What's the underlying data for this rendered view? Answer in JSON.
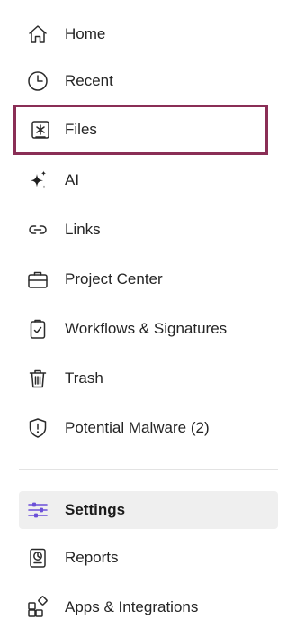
{
  "nav": {
    "items": [
      {
        "label": "Home",
        "icon": "home-icon"
      },
      {
        "label": "Recent",
        "icon": "clock-icon"
      },
      {
        "label": "Files",
        "icon": "files-icon"
      },
      {
        "label": "AI",
        "icon": "sparkle-icon"
      },
      {
        "label": "Links",
        "icon": "link-icon"
      },
      {
        "label": "Project Center",
        "icon": "briefcase-icon"
      },
      {
        "label": "Workflows & Signatures",
        "icon": "clipboard-check-icon"
      },
      {
        "label": "Trash",
        "icon": "trash-icon"
      },
      {
        "label": "Potential Malware (2)",
        "icon": "shield-alert-icon"
      }
    ],
    "secondary": [
      {
        "label": "Settings",
        "icon": "sliders-icon"
      },
      {
        "label": "Reports",
        "icon": "report-icon"
      },
      {
        "label": "Apps & Integrations",
        "icon": "apps-icon"
      }
    ]
  },
  "colors": {
    "focus_outline": "#8a2e56",
    "selected_bg": "#efefef",
    "settings_icon": "#6b4fd8"
  }
}
